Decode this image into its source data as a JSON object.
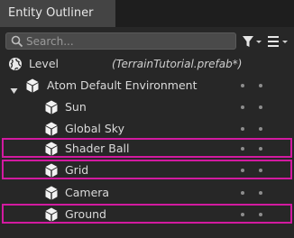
{
  "panel": {
    "tab_title": "Entity Outliner"
  },
  "toolbar": {
    "search_placeholder": "Search...",
    "filter_icon": "filter-icon",
    "display_icon": "display-options-icon"
  },
  "tree": {
    "level": {
      "label": "Level",
      "prefab": "(TerrainTutorial.prefab*)",
      "icon": "globe-icon"
    },
    "root": {
      "label": "Atom Default Environment",
      "expanded": true,
      "icon": "entity-cube-icon"
    },
    "children": [
      {
        "label": "Sun",
        "highlighted": false
      },
      {
        "label": "Global Sky",
        "highlighted": false
      },
      {
        "label": "Shader Ball",
        "highlighted": true
      },
      {
        "label": "Grid",
        "highlighted": true
      },
      {
        "label": "Camera",
        "highlighted": false
      },
      {
        "label": "Ground",
        "highlighted": true
      }
    ]
  },
  "colors": {
    "panel_bg": "#272727",
    "tab_bg": "#444444",
    "highlight_outline": "#d21aa0",
    "text": "#dadada"
  }
}
